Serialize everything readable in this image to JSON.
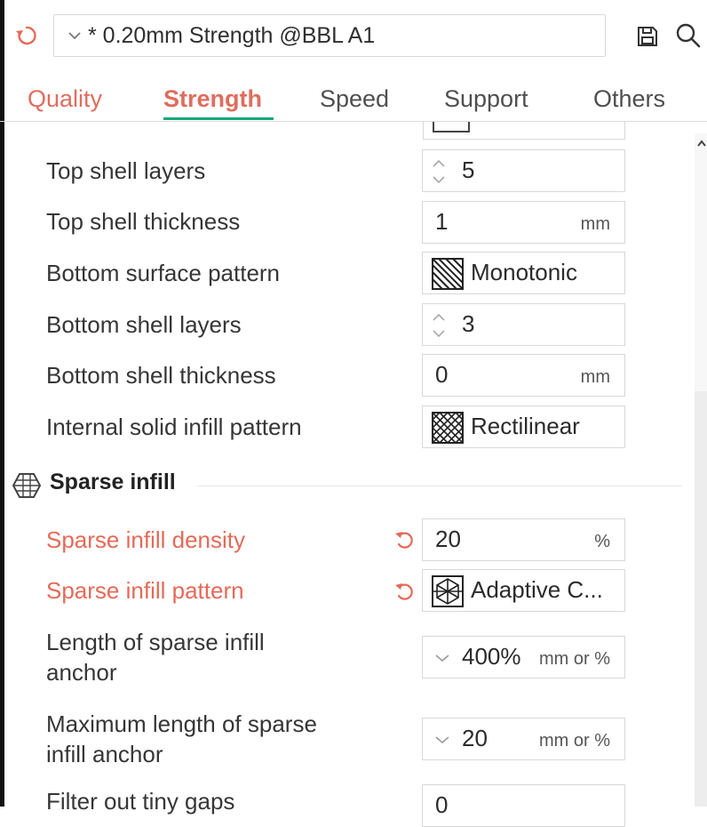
{
  "header": {
    "preset_name": "* 0.20mm Strength @BBL A1",
    "icons": [
      "reset-icon",
      "chevron-down-icon",
      "save-icon",
      "search-icon"
    ]
  },
  "tabs": [
    {
      "label": "Quality"
    },
    {
      "label": "Strength",
      "active": true
    },
    {
      "label": "Speed"
    },
    {
      "label": "Support"
    },
    {
      "label": "Others"
    }
  ],
  "rows": {
    "top_shell_layers": {
      "label": "Top shell layers",
      "value": "5"
    },
    "top_shell_thickness": {
      "label": "Top shell thickness",
      "value": "1",
      "unit": "mm"
    },
    "bottom_surface_pattern": {
      "label": "Bottom surface pattern",
      "value": "Monotonic"
    },
    "bottom_shell_layers": {
      "label": "Bottom shell layers",
      "value": "3"
    },
    "bottom_shell_thickness": {
      "label": "Bottom shell thickness",
      "value": "0",
      "unit": "mm"
    },
    "internal_solid_infill_pattern": {
      "label": "Internal solid infill pattern",
      "value": "Rectilinear"
    }
  },
  "sparse_section": {
    "title": "Sparse infill",
    "density": {
      "label": "Sparse infill density",
      "value": "20",
      "unit": "%"
    },
    "pattern": {
      "label": "Sparse infill pattern",
      "value": "Adaptive C..."
    },
    "anchor": {
      "label_line1": "Length of sparse infill",
      "label_line2": "anchor",
      "value": "400%",
      "unit": "mm or %"
    },
    "anchor_max": {
      "label_line1": "Maximum length of sparse",
      "label_line2": "infill anchor",
      "value": "20",
      "unit": "mm or %"
    },
    "filter_gaps": {
      "label": "Filter out tiny gaps",
      "value": "0"
    }
  },
  "colors": {
    "modified": "#e46a58",
    "active_tab_underline": "#11a77a",
    "text": "#363636"
  }
}
